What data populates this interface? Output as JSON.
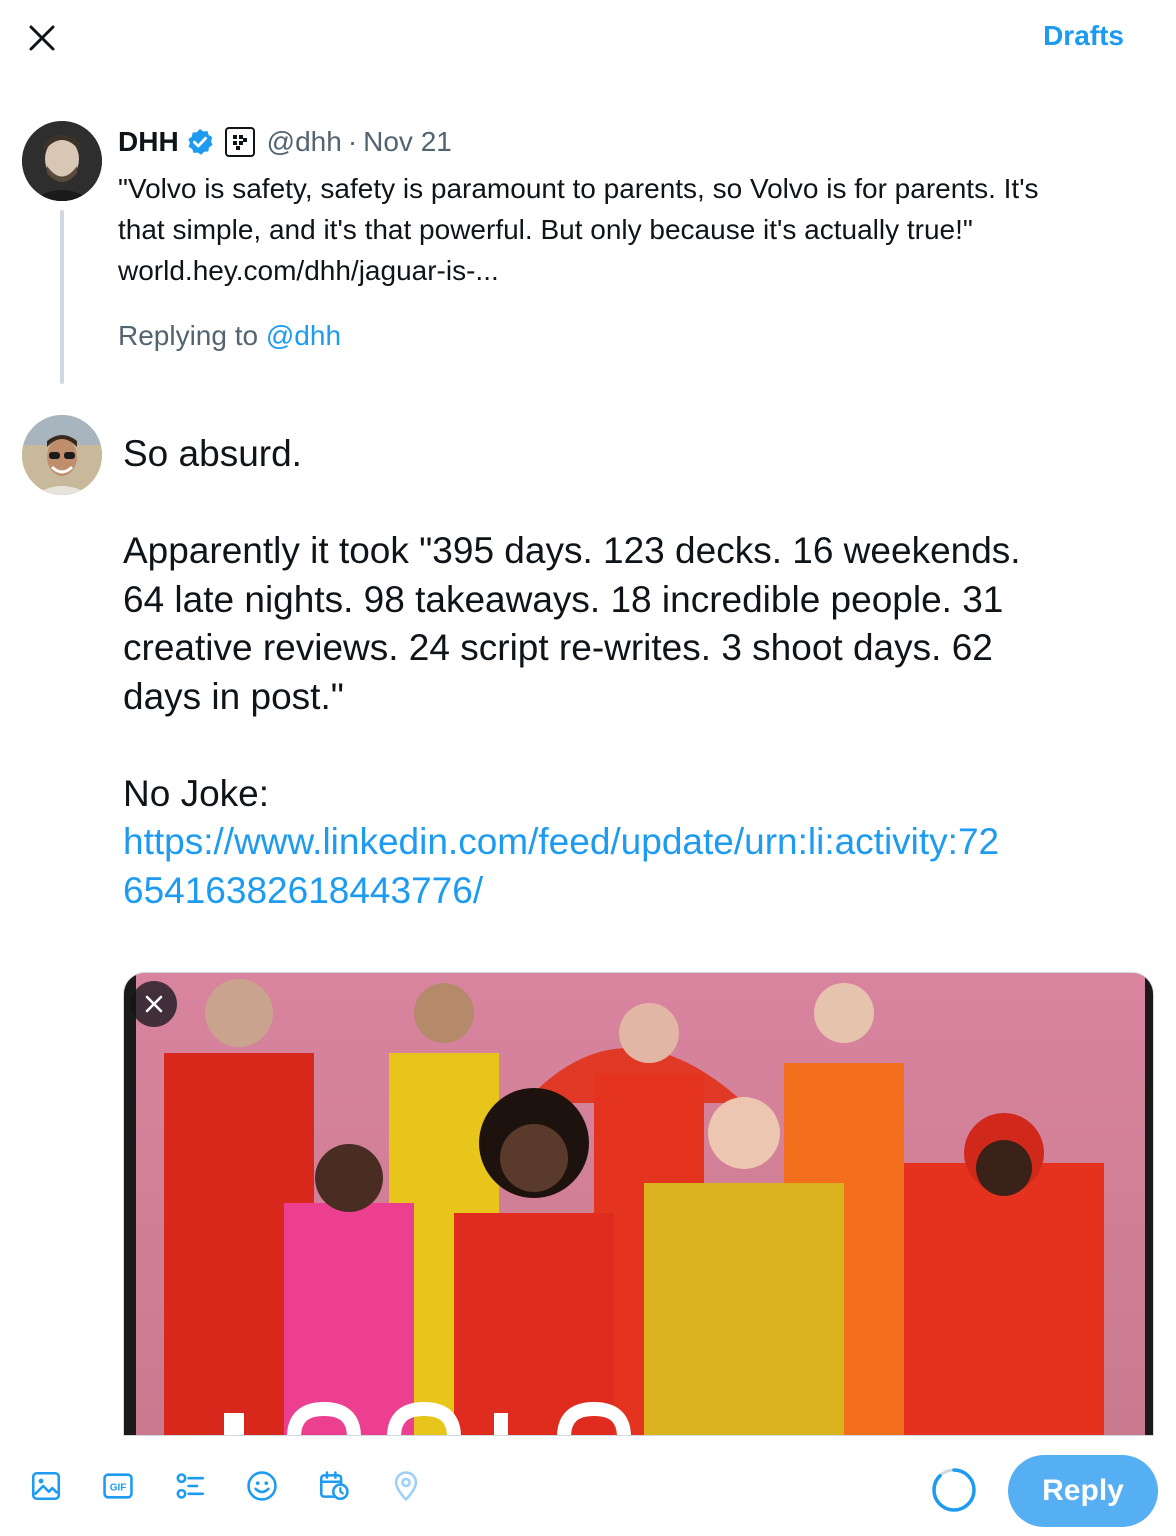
{
  "header": {
    "drafts_label": "Drafts"
  },
  "original_tweet": {
    "name": "DHH",
    "handle": "@dhh",
    "separator": "·",
    "date": "Nov 21",
    "text_lines": [
      "\"Volvo is safety, safety is paramount to parents, so Volvo is for parents. It's",
      "that simple, and it's that powerful. But only because it's actually true!\"",
      "world.hey.com/dhh/jaguar-is-..."
    ]
  },
  "replying": {
    "prefix": "Replying to",
    "mention": "@dhh"
  },
  "compose": {
    "paragraph1": "So absurd.",
    "paragraph2_lines": [
      "Apparently it took \"395 days. 123 decks. 16 weekends.",
      "64 late nights. 98 takeaways. 18 incredible people. 31",
      "creative reviews. 24 script re-writes. 3 shoot days. 62",
      "days in post.\""
    ],
    "paragraph3": "No Joke:",
    "link_lines": [
      "https://www.linkedin.com/feed/update/urn:li:activity:72",
      "65416382618443776/"
    ]
  },
  "toolbar": {
    "icons": [
      "image-icon",
      "gif-icon",
      "poll-icon",
      "emoji-icon",
      "schedule-icon",
      "location-icon"
    ],
    "gif_text": "GIF",
    "reply_label": "Reply"
  },
  "colors": {
    "accent": "#1d9bf0",
    "reply_button": "#56aef3",
    "muted": "#536471",
    "thread_line": "#cfd9de"
  }
}
